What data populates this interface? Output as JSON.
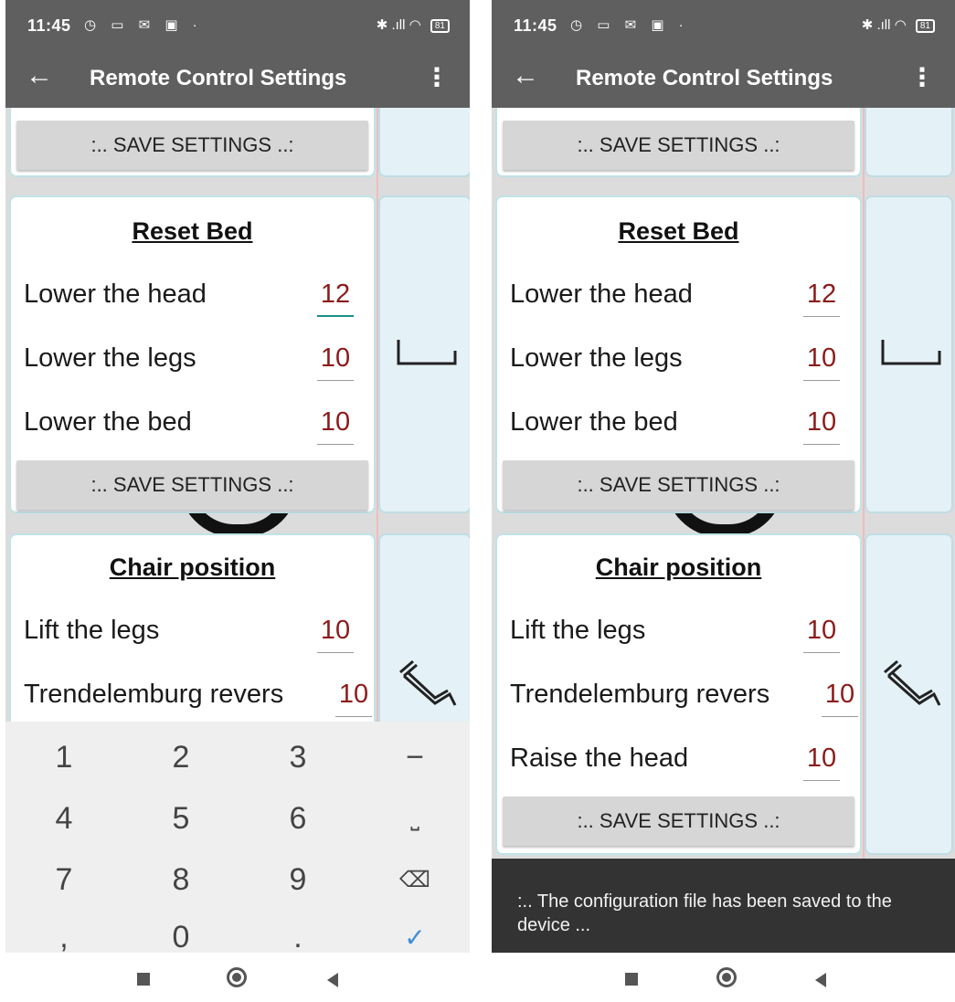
{
  "status": {
    "time": "11:45",
    "battery": "81",
    "left_icons": "◷ ▭ ✉ ▣ ·",
    "right_icons": "✱ .ıll ◠"
  },
  "appbar": {
    "title": "Remote Control Settings"
  },
  "save_label": ":.. SAVE SETTINGS ..:",
  "reset_bed": {
    "title": "Reset Bed",
    "rows": [
      {
        "label": "Lower the head",
        "value": "12"
      },
      {
        "label": "Lower the legs",
        "value": "10"
      },
      {
        "label": "Lower the bed",
        "value": "10"
      }
    ]
  },
  "chair_position": {
    "title": "Chair position",
    "rows": [
      {
        "label": "Lift the legs",
        "value": "10"
      },
      {
        "label": "Trendelemburg revers",
        "value": "10"
      },
      {
        "label": "Raise the head",
        "value": "10"
      }
    ]
  },
  "numpad": {
    "keys": [
      "1",
      "2",
      "3",
      "−",
      "4",
      "5",
      "6",
      "⎵",
      "7",
      "8",
      "9",
      "⌫",
      ",",
      "0",
      ".",
      "✓"
    ]
  },
  "snackbar": {
    "message": ":.. The configuration file has been saved to the device ..."
  },
  "colors": {
    "appbar": "#5f5f5f",
    "value_text": "#8b1b1b",
    "focus_underline": "#1a8f88",
    "side_panel": "#e4f1f7"
  }
}
